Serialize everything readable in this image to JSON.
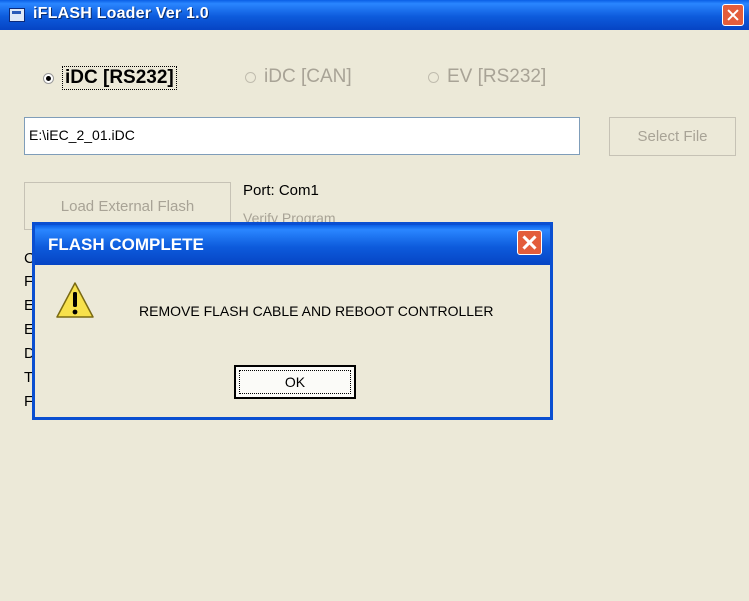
{
  "window": {
    "title": "iFLASH Loader Ver 1.0",
    "icon": "app-window-icon",
    "close_icon": "close-icon"
  },
  "radios": [
    {
      "label": "iDC [RS232]",
      "selected": true,
      "enabled": true
    },
    {
      "label": "iDC [CAN]",
      "selected": false,
      "enabled": false
    },
    {
      "label": "EV [RS232]",
      "selected": false,
      "enabled": false
    }
  ],
  "file": {
    "path": "E:\\iEC_2_01.iDC",
    "select_button": "Select File"
  },
  "load_button": "Load External Flash",
  "port_label": "Port: Com1",
  "verify_label": "Verify Program",
  "side_letters": [
    "C",
    "F",
    "E",
    "E",
    "D",
    "T",
    "F"
  ],
  "dialog": {
    "title": "FLASH COMPLETE",
    "message": "REMOVE FLASH CABLE AND REBOOT CONTROLLER",
    "ok_label": "OK",
    "icon": "warning-icon"
  },
  "colors": {
    "titlebar": "#0d5bdc",
    "window_bg": "#ece9d8",
    "close": "#e35d3b",
    "disabled_text": "#a8a396"
  }
}
